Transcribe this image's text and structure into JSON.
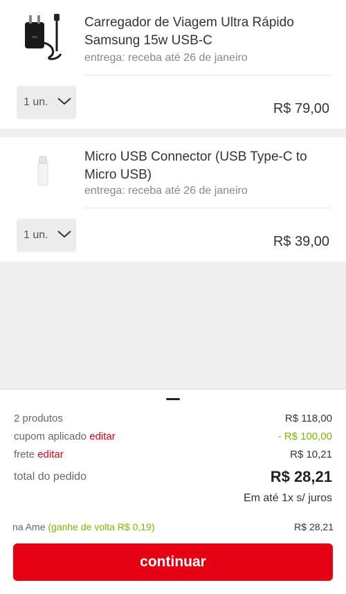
{
  "items": [
    {
      "title": "Carregador de Viagem Ultra Rápido Samsung 15w USB-C",
      "delivery": "entrega: receba até 26 de janeiro",
      "quantity": "1 un.",
      "price": "R$ 79,00",
      "image_icon": "charger-icon"
    },
    {
      "title": "Micro USB Connector (USB Type-C to Micro USB)",
      "delivery": "entrega: receba até 26 de janeiro",
      "quantity": "1 un.",
      "price": "R$ 39,00",
      "image_icon": "usb-adapter-icon"
    }
  ],
  "summary": {
    "products_label": "2 produtos",
    "products_value": "R$ 118,00",
    "coupon_label": "cupom aplicado",
    "coupon_edit": "editar",
    "coupon_value": "- R$ 100,00",
    "shipping_label": "frete",
    "shipping_edit": "editar",
    "shipping_value": "R$ 10,21",
    "total_label": "total do pedido",
    "total_value": "R$ 28,21",
    "installments": "Em até 1x s/ juros",
    "ame_label": "na Ame",
    "ame_cashback": "(ganhe de volta R$ 0,19)",
    "ame_value": "R$ 28,21"
  },
  "continue_label": "continuar",
  "colors": {
    "accent": "#e60014",
    "cashback": "#7ab800"
  }
}
